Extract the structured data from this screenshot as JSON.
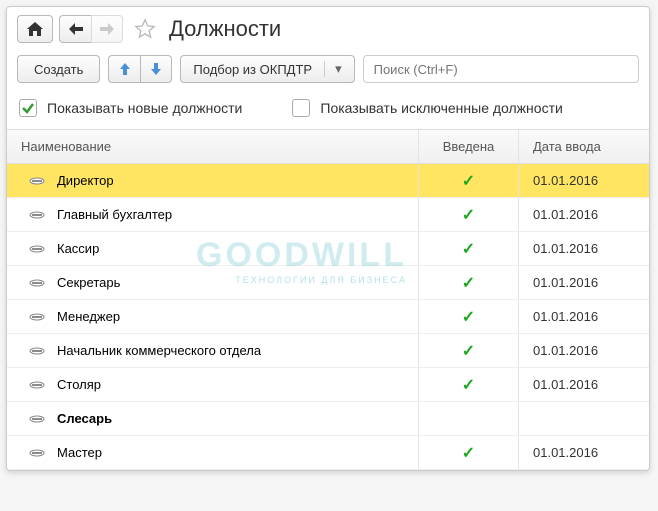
{
  "header": {
    "title": "Должности"
  },
  "toolbar": {
    "create_label": "Создать",
    "okpdtr_label": "Подбор из ОКПДТР",
    "search_placeholder": "Поиск (Ctrl+F)"
  },
  "filters": {
    "show_new_label": "Показывать новые должности",
    "show_new_checked": true,
    "show_excluded_label": "Показывать исключенные должности",
    "show_excluded_checked": false
  },
  "columns": {
    "name": "Наименование",
    "introduced": "Введена",
    "date": "Дата ввода"
  },
  "rows": [
    {
      "name": "Директор",
      "introduced": true,
      "date": "01.01.2016",
      "selected": true,
      "bold": false
    },
    {
      "name": "Главный бухгалтер",
      "introduced": true,
      "date": "01.01.2016",
      "selected": false,
      "bold": false
    },
    {
      "name": "Кассир",
      "introduced": true,
      "date": "01.01.2016",
      "selected": false,
      "bold": false
    },
    {
      "name": "Секретарь",
      "introduced": true,
      "date": "01.01.2016",
      "selected": false,
      "bold": false
    },
    {
      "name": "Менеджер",
      "introduced": true,
      "date": "01.01.2016",
      "selected": false,
      "bold": false
    },
    {
      "name": "Начальник коммерческого отдела",
      "introduced": true,
      "date": "01.01.2016",
      "selected": false,
      "bold": false
    },
    {
      "name": "Столяр",
      "introduced": true,
      "date": "01.01.2016",
      "selected": false,
      "bold": false
    },
    {
      "name": "Слесарь",
      "introduced": false,
      "date": "",
      "selected": false,
      "bold": true
    },
    {
      "name": "Мастер",
      "introduced": true,
      "date": "01.01.2016",
      "selected": false,
      "bold": false
    }
  ],
  "watermark": {
    "main": "GOODWILL",
    "sub": "ТЕХНОЛОГИИ  ДЛЯ  БИЗНЕСА"
  }
}
